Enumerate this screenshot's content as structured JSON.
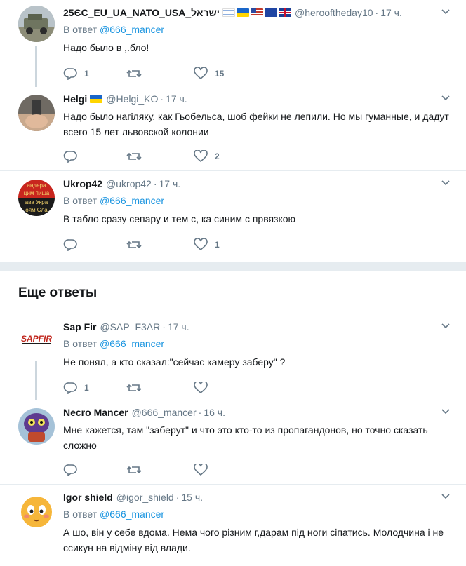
{
  "tweets_top": [
    {
      "name": "25ЄС_EU_UA_NATO_USA_ישראל",
      "handle": "@herooftheday10",
      "time": "17 ч.",
      "reply_to_label": "В ответ",
      "reply_to_user": "@666_mancer",
      "text": "Надо было в ,.бло!",
      "replies": "1",
      "retweets": "",
      "likes": "15"
    },
    {
      "name": "Helgi",
      "handle": "@Helgi_KO",
      "time": "17 ч.",
      "text": "Надо было нагiляку, как Гьобельса, шоб фейки не лепили. Но мы гуманные, и дадут всего 15 лет львовской колонии",
      "replies": "",
      "retweets": "",
      "likes": "2"
    },
    {
      "name": "Ukrop42",
      "handle": "@ukrop42",
      "time": "17 ч.",
      "reply_to_label": "В ответ",
      "reply_to_user": "@666_mancer",
      "text": "В табло сразу сепару и тем с, ка синим с првязкою",
      "replies": "",
      "retweets": "",
      "likes": "1",
      "avatar_text": "андера\nцим пиша\nава Укра\nоям Сла"
    }
  ],
  "section_title": "Еще ответы",
  "tweets_more": [
    {
      "name": "Sap Fir",
      "handle": "@SAP_F3AR",
      "time": "17 ч.",
      "reply_to_label": "В ответ",
      "reply_to_user": "@666_mancer",
      "text": "Не понял, а кто сказал:\"сейчас камеру заберу\" ?",
      "replies": "1",
      "retweets": "",
      "likes": "",
      "avatar_text": "SAPFIR"
    },
    {
      "name": "Necro Mancer",
      "handle": "@666_mancer",
      "time": "16 ч.",
      "text": "Мне кажется, там \"заберут\" и что это кто-то из пропагандонов, но точно сказать сложно",
      "replies": "",
      "retweets": "",
      "likes": ""
    },
    {
      "name": "Igor shield",
      "handle": "@igor_shield",
      "time": "15 ч.",
      "reply_to_label": "В ответ",
      "reply_to_user": "@666_mancer",
      "text": "А шо, він у себе вдома. Нема чого різним г,дарам під ноги сіпатись. Молодчина і не ссикун на відміну від влади."
    }
  ],
  "dot": "·",
  "colors": {
    "link": "#1b95e0",
    "muted": "#657786",
    "border": "#e6ecf0",
    "thread_line": "#ccd6dd"
  }
}
